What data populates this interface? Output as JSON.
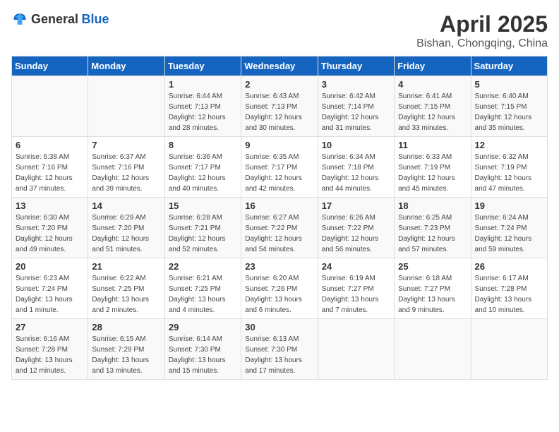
{
  "logo": {
    "general": "General",
    "blue": "Blue"
  },
  "title": "April 2025",
  "subtitle": "Bishan, Chongqing, China",
  "weekdays": [
    "Sunday",
    "Monday",
    "Tuesday",
    "Wednesday",
    "Thursday",
    "Friday",
    "Saturday"
  ],
  "weeks": [
    [
      null,
      null,
      {
        "day": 1,
        "sunrise": "6:44 AM",
        "sunset": "7:13 PM",
        "daylight": "12 hours and 28 minutes."
      },
      {
        "day": 2,
        "sunrise": "6:43 AM",
        "sunset": "7:13 PM",
        "daylight": "12 hours and 30 minutes."
      },
      {
        "day": 3,
        "sunrise": "6:42 AM",
        "sunset": "7:14 PM",
        "daylight": "12 hours and 31 minutes."
      },
      {
        "day": 4,
        "sunrise": "6:41 AM",
        "sunset": "7:15 PM",
        "daylight": "12 hours and 33 minutes."
      },
      {
        "day": 5,
        "sunrise": "6:40 AM",
        "sunset": "7:15 PM",
        "daylight": "12 hours and 35 minutes."
      }
    ],
    [
      {
        "day": 6,
        "sunrise": "6:38 AM",
        "sunset": "7:16 PM",
        "daylight": "12 hours and 37 minutes."
      },
      {
        "day": 7,
        "sunrise": "6:37 AM",
        "sunset": "7:16 PM",
        "daylight": "12 hours and 39 minutes."
      },
      {
        "day": 8,
        "sunrise": "6:36 AM",
        "sunset": "7:17 PM",
        "daylight": "12 hours and 40 minutes."
      },
      {
        "day": 9,
        "sunrise": "6:35 AM",
        "sunset": "7:17 PM",
        "daylight": "12 hours and 42 minutes."
      },
      {
        "day": 10,
        "sunrise": "6:34 AM",
        "sunset": "7:18 PM",
        "daylight": "12 hours and 44 minutes."
      },
      {
        "day": 11,
        "sunrise": "6:33 AM",
        "sunset": "7:19 PM",
        "daylight": "12 hours and 45 minutes."
      },
      {
        "day": 12,
        "sunrise": "6:32 AM",
        "sunset": "7:19 PM",
        "daylight": "12 hours and 47 minutes."
      }
    ],
    [
      {
        "day": 13,
        "sunrise": "6:30 AM",
        "sunset": "7:20 PM",
        "daylight": "12 hours and 49 minutes."
      },
      {
        "day": 14,
        "sunrise": "6:29 AM",
        "sunset": "7:20 PM",
        "daylight": "12 hours and 51 minutes."
      },
      {
        "day": 15,
        "sunrise": "6:28 AM",
        "sunset": "7:21 PM",
        "daylight": "12 hours and 52 minutes."
      },
      {
        "day": 16,
        "sunrise": "6:27 AM",
        "sunset": "7:22 PM",
        "daylight": "12 hours and 54 minutes."
      },
      {
        "day": 17,
        "sunrise": "6:26 AM",
        "sunset": "7:22 PM",
        "daylight": "12 hours and 56 minutes."
      },
      {
        "day": 18,
        "sunrise": "6:25 AM",
        "sunset": "7:23 PM",
        "daylight": "12 hours and 57 minutes."
      },
      {
        "day": 19,
        "sunrise": "6:24 AM",
        "sunset": "7:24 PM",
        "daylight": "12 hours and 59 minutes."
      }
    ],
    [
      {
        "day": 20,
        "sunrise": "6:23 AM",
        "sunset": "7:24 PM",
        "daylight": "13 hours and 1 minute."
      },
      {
        "day": 21,
        "sunrise": "6:22 AM",
        "sunset": "7:25 PM",
        "daylight": "13 hours and 2 minutes."
      },
      {
        "day": 22,
        "sunrise": "6:21 AM",
        "sunset": "7:25 PM",
        "daylight": "13 hours and 4 minutes."
      },
      {
        "day": 23,
        "sunrise": "6:20 AM",
        "sunset": "7:26 PM",
        "daylight": "13 hours and 6 minutes."
      },
      {
        "day": 24,
        "sunrise": "6:19 AM",
        "sunset": "7:27 PM",
        "daylight": "13 hours and 7 minutes."
      },
      {
        "day": 25,
        "sunrise": "6:18 AM",
        "sunset": "7:27 PM",
        "daylight": "13 hours and 9 minutes."
      },
      {
        "day": 26,
        "sunrise": "6:17 AM",
        "sunset": "7:28 PM",
        "daylight": "13 hours and 10 minutes."
      }
    ],
    [
      {
        "day": 27,
        "sunrise": "6:16 AM",
        "sunset": "7:28 PM",
        "daylight": "13 hours and 12 minutes."
      },
      {
        "day": 28,
        "sunrise": "6:15 AM",
        "sunset": "7:29 PM",
        "daylight": "13 hours and 13 minutes."
      },
      {
        "day": 29,
        "sunrise": "6:14 AM",
        "sunset": "7:30 PM",
        "daylight": "13 hours and 15 minutes."
      },
      {
        "day": 30,
        "sunrise": "6:13 AM",
        "sunset": "7:30 PM",
        "daylight": "13 hours and 17 minutes."
      },
      null,
      null,
      null
    ]
  ],
  "labels": {
    "sunrise_prefix": "Sunrise: ",
    "sunset_prefix": "Sunset: ",
    "daylight_prefix": "Daylight: "
  }
}
